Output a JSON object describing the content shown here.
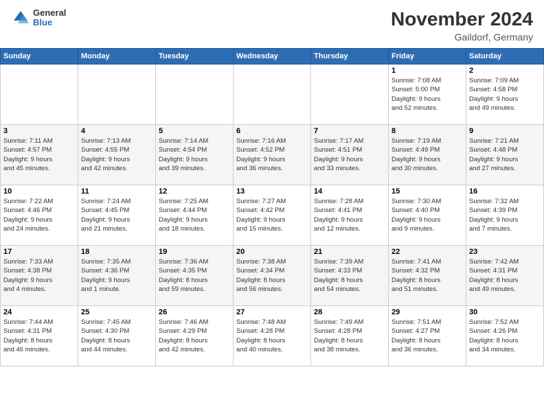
{
  "logo": {
    "general": "General",
    "blue": "Blue"
  },
  "title": "November 2024",
  "location": "Gaildorf, Germany",
  "days_header": [
    "Sunday",
    "Monday",
    "Tuesday",
    "Wednesday",
    "Thursday",
    "Friday",
    "Saturday"
  ],
  "weeks": [
    [
      {
        "day": "",
        "info": ""
      },
      {
        "day": "",
        "info": ""
      },
      {
        "day": "",
        "info": ""
      },
      {
        "day": "",
        "info": ""
      },
      {
        "day": "",
        "info": ""
      },
      {
        "day": "1",
        "info": "Sunrise: 7:08 AM\nSunset: 5:00 PM\nDaylight: 9 hours\nand 52 minutes."
      },
      {
        "day": "2",
        "info": "Sunrise: 7:09 AM\nSunset: 4:58 PM\nDaylight: 9 hours\nand 49 minutes."
      }
    ],
    [
      {
        "day": "3",
        "info": "Sunrise: 7:11 AM\nSunset: 4:57 PM\nDaylight: 9 hours\nand 45 minutes."
      },
      {
        "day": "4",
        "info": "Sunrise: 7:13 AM\nSunset: 4:55 PM\nDaylight: 9 hours\nand 42 minutes."
      },
      {
        "day": "5",
        "info": "Sunrise: 7:14 AM\nSunset: 4:54 PM\nDaylight: 9 hours\nand 39 minutes."
      },
      {
        "day": "6",
        "info": "Sunrise: 7:16 AM\nSunset: 4:52 PM\nDaylight: 9 hours\nand 36 minutes."
      },
      {
        "day": "7",
        "info": "Sunrise: 7:17 AM\nSunset: 4:51 PM\nDaylight: 9 hours\nand 33 minutes."
      },
      {
        "day": "8",
        "info": "Sunrise: 7:19 AM\nSunset: 4:49 PM\nDaylight: 9 hours\nand 30 minutes."
      },
      {
        "day": "9",
        "info": "Sunrise: 7:21 AM\nSunset: 4:48 PM\nDaylight: 9 hours\nand 27 minutes."
      }
    ],
    [
      {
        "day": "10",
        "info": "Sunrise: 7:22 AM\nSunset: 4:46 PM\nDaylight: 9 hours\nand 24 minutes."
      },
      {
        "day": "11",
        "info": "Sunrise: 7:24 AM\nSunset: 4:45 PM\nDaylight: 9 hours\nand 21 minutes."
      },
      {
        "day": "12",
        "info": "Sunrise: 7:25 AM\nSunset: 4:44 PM\nDaylight: 9 hours\nand 18 minutes."
      },
      {
        "day": "13",
        "info": "Sunrise: 7:27 AM\nSunset: 4:42 PM\nDaylight: 9 hours\nand 15 minutes."
      },
      {
        "day": "14",
        "info": "Sunrise: 7:28 AM\nSunset: 4:41 PM\nDaylight: 9 hours\nand 12 minutes."
      },
      {
        "day": "15",
        "info": "Sunrise: 7:30 AM\nSunset: 4:40 PM\nDaylight: 9 hours\nand 9 minutes."
      },
      {
        "day": "16",
        "info": "Sunrise: 7:32 AM\nSunset: 4:39 PM\nDaylight: 9 hours\nand 7 minutes."
      }
    ],
    [
      {
        "day": "17",
        "info": "Sunrise: 7:33 AM\nSunset: 4:38 PM\nDaylight: 9 hours\nand 4 minutes."
      },
      {
        "day": "18",
        "info": "Sunrise: 7:35 AM\nSunset: 4:36 PM\nDaylight: 9 hours\nand 1 minute."
      },
      {
        "day": "19",
        "info": "Sunrise: 7:36 AM\nSunset: 4:35 PM\nDaylight: 8 hours\nand 59 minutes."
      },
      {
        "day": "20",
        "info": "Sunrise: 7:38 AM\nSunset: 4:34 PM\nDaylight: 8 hours\nand 56 minutes."
      },
      {
        "day": "21",
        "info": "Sunrise: 7:39 AM\nSunset: 4:33 PM\nDaylight: 8 hours\nand 54 minutes."
      },
      {
        "day": "22",
        "info": "Sunrise: 7:41 AM\nSunset: 4:32 PM\nDaylight: 8 hours\nand 51 minutes."
      },
      {
        "day": "23",
        "info": "Sunrise: 7:42 AM\nSunset: 4:31 PM\nDaylight: 8 hours\nand 49 minutes."
      }
    ],
    [
      {
        "day": "24",
        "info": "Sunrise: 7:44 AM\nSunset: 4:31 PM\nDaylight: 8 hours\nand 46 minutes."
      },
      {
        "day": "25",
        "info": "Sunrise: 7:45 AM\nSunset: 4:30 PM\nDaylight: 8 hours\nand 44 minutes."
      },
      {
        "day": "26",
        "info": "Sunrise: 7:46 AM\nSunset: 4:29 PM\nDaylight: 8 hours\nand 42 minutes."
      },
      {
        "day": "27",
        "info": "Sunrise: 7:48 AM\nSunset: 4:28 PM\nDaylight: 8 hours\nand 40 minutes."
      },
      {
        "day": "28",
        "info": "Sunrise: 7:49 AM\nSunset: 4:28 PM\nDaylight: 8 hours\nand 38 minutes."
      },
      {
        "day": "29",
        "info": "Sunrise: 7:51 AM\nSunset: 4:27 PM\nDaylight: 8 hours\nand 36 minutes."
      },
      {
        "day": "30",
        "info": "Sunrise: 7:52 AM\nSunset: 4:26 PM\nDaylight: 8 hours\nand 34 minutes."
      }
    ]
  ]
}
